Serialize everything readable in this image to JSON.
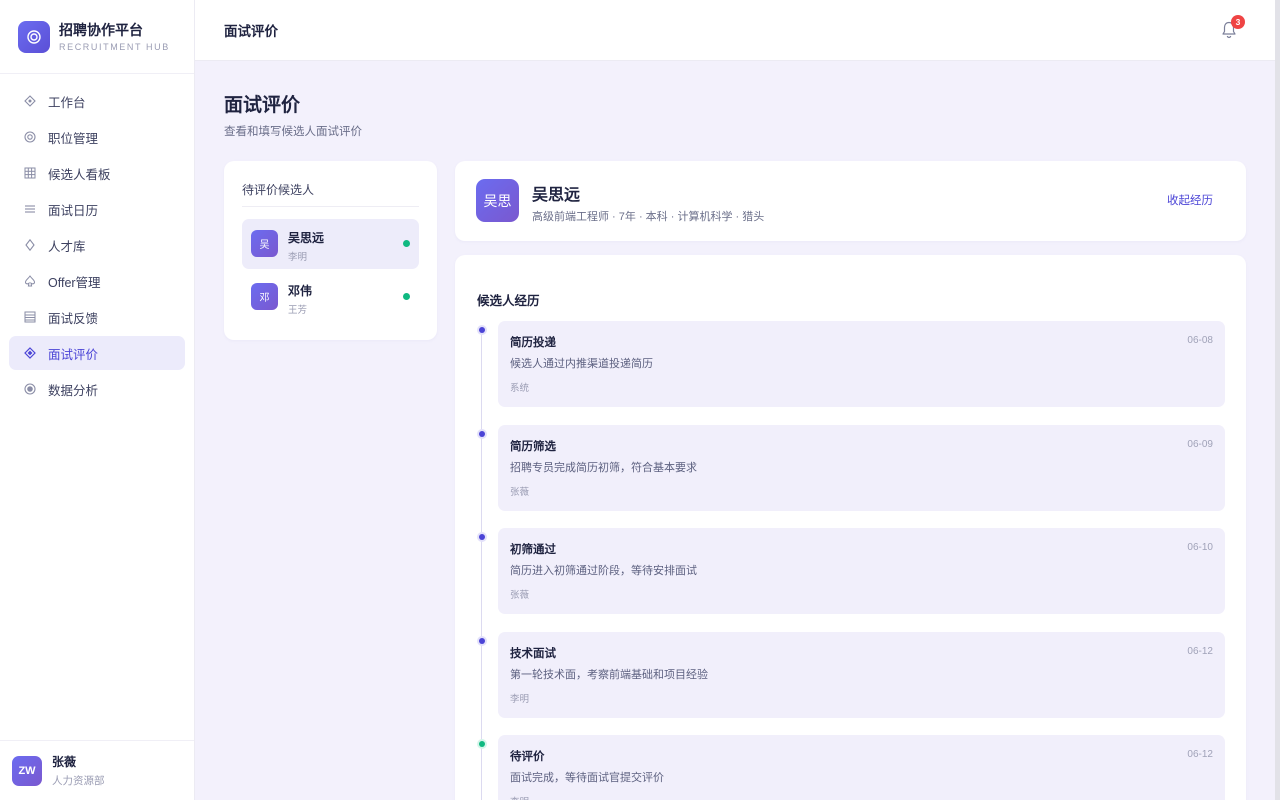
{
  "brand": {
    "name": "招聘协作平台",
    "subtitle": "RECRUITMENT HUB"
  },
  "nav": [
    {
      "label": "工作台",
      "icon": "diamond-icon"
    },
    {
      "label": "职位管理",
      "icon": "target-icon"
    },
    {
      "label": "候选人看板",
      "icon": "grid-icon"
    },
    {
      "label": "面试日历",
      "icon": "list-icon"
    },
    {
      "label": "人才库",
      "icon": "diamond-outline-icon"
    },
    {
      "label": "Offer管理",
      "icon": "spade-icon"
    },
    {
      "label": "面试反馈",
      "icon": "table-icon"
    },
    {
      "label": "面试评价",
      "icon": "diamond-active-icon",
      "active": true
    },
    {
      "label": "数据分析",
      "icon": "circle-dot-icon"
    }
  ],
  "user": {
    "initials": "ZW",
    "name": "张薇",
    "dept": "人力资源部"
  },
  "topbar": {
    "title": "面试评价",
    "notification_count": "3"
  },
  "page": {
    "title": "面试评价",
    "subtitle": "查看和填写候选人面试评价"
  },
  "candidates": {
    "title": "待评价候选人",
    "items": [
      {
        "avatar": "吴",
        "name": "吴思远",
        "owner": "李明",
        "status_color": "#10b981",
        "selected": true
      },
      {
        "avatar": "邓",
        "name": "邓伟",
        "owner": "王芳",
        "status_color": "#10b981",
        "selected": false
      }
    ]
  },
  "profile": {
    "avatar": "吴思",
    "name": "吴思远",
    "meta": "高级前端工程师 · 7年 · 本科 · 计算机科学 · 猎头",
    "collapse_label": "收起经历"
  },
  "timeline": {
    "title": "候选人经历",
    "items": [
      {
        "title": "简历投递",
        "date": "06-08",
        "desc": "候选人通过内推渠道投递简历",
        "by": "系统",
        "dot": "#4b44d6"
      },
      {
        "title": "简历筛选",
        "date": "06-09",
        "desc": "招聘专员完成简历初筛，符合基本要求",
        "by": "张薇",
        "dot": "#4b44d6"
      },
      {
        "title": "初筛通过",
        "date": "06-10",
        "desc": "简历进入初筛通过阶段，等待安排面试",
        "by": "张薇",
        "dot": "#4b44d6"
      },
      {
        "title": "技术面试",
        "date": "06-12",
        "desc": "第一轮技术面，考察前端基础和项目经验",
        "by": "李明",
        "dot": "#4b44d6"
      },
      {
        "title": "待评价",
        "date": "06-12",
        "desc": "面试完成，等待面试官提交评价",
        "by": "李明",
        "dot": "#10b981"
      }
    ]
  },
  "colors": {
    "accent": "#4b44d6",
    "success": "#10b981",
    "badge": "#ef4444",
    "background": "#f3f1fc"
  }
}
